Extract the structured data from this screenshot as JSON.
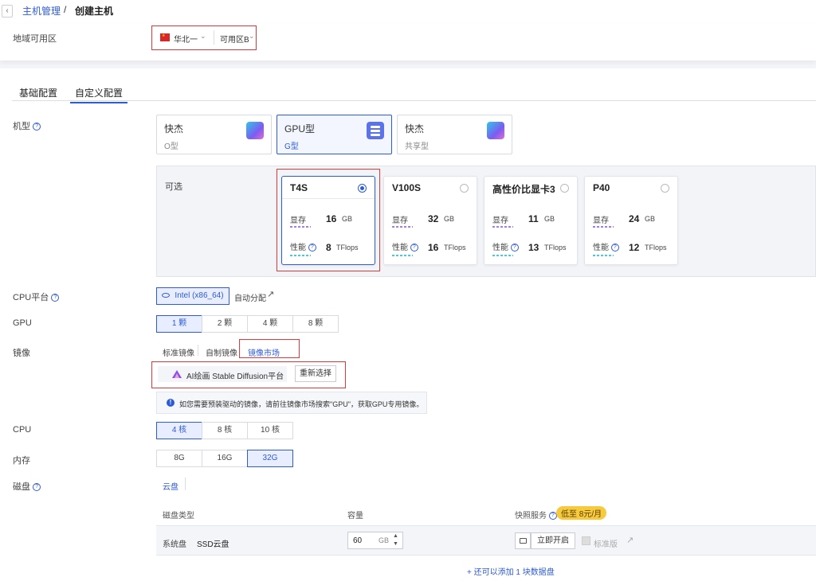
{
  "breadcrumb": {
    "back": "‹",
    "parent": "主机管理",
    "sep": "/",
    "current": "创建主机"
  },
  "region": {
    "label": "地域可用区",
    "flag": "flag-icon",
    "region_value": "华北一",
    "zone_value": "可用区B"
  },
  "tabs": [
    {
      "label": "基础配置"
    },
    {
      "label": "自定义配置"
    }
  ],
  "machine_type": {
    "label": "机型",
    "cards": [
      {
        "title": "快杰",
        "sub": "O型"
      },
      {
        "title": "GPU型",
        "sub": "G型"
      },
      {
        "title": "快杰",
        "sub": "共享型"
      }
    ]
  },
  "gpu_options": {
    "label": "可选",
    "mem_label": "显存",
    "perf_label": "性能",
    "mem_unit": "GB",
    "perf_unit": "TFlops",
    "cards": [
      {
        "name": "T4S",
        "mem": "16",
        "perf": "8",
        "selected": true
      },
      {
        "name": "V100S",
        "mem": "32",
        "perf": "16",
        "selected": false
      },
      {
        "name": "高性价比显卡3",
        "mem": "11",
        "perf": "13",
        "selected": false
      },
      {
        "name": "P40",
        "mem": "24",
        "perf": "12",
        "selected": false
      }
    ]
  },
  "cpu_platform": {
    "label": "CPU平台",
    "option": "Intel (x86_64)",
    "auto": "自动分配"
  },
  "gpu_count": {
    "label": "GPU",
    "options": [
      "1 颗",
      "2 颗",
      "4 颗",
      "8 颗"
    ],
    "selected": 0
  },
  "image": {
    "label": "镜像",
    "tabs": [
      "标准镜像",
      "自制镜像",
      "镜像市场"
    ],
    "selected_name": "AI绘画 Stable Diffusion平台",
    "reselect": "重新选择",
    "info": "如您需要预装驱动的镜像，请前往镜像市场搜索\"GPU\"，获取GPU专用镜像。"
  },
  "cpu": {
    "label": "CPU",
    "options": [
      "4 核",
      "8 核",
      "10 核"
    ],
    "selected": 0
  },
  "memory": {
    "label": "内存",
    "options": [
      "8G",
      "16G",
      "32G"
    ],
    "selected": 2
  },
  "disk": {
    "label": "磁盘",
    "tab": "云盘",
    "headers": {
      "type": "磁盘类型",
      "capacity": "容量",
      "snapshot": "快照服务"
    },
    "price_pill": "低至 8元/月",
    "row": {
      "kind": "系统盘",
      "type": "SSD云盘",
      "size": "60",
      "unit": "GB",
      "enable": "立即开启",
      "standard": "标准版"
    },
    "add_more": "+ 还可以添加 1 块数据盘"
  },
  "colors": {
    "accent": "#2e5bd8",
    "highlight": "#e03a3a",
    "pill": "#f7c93c"
  }
}
